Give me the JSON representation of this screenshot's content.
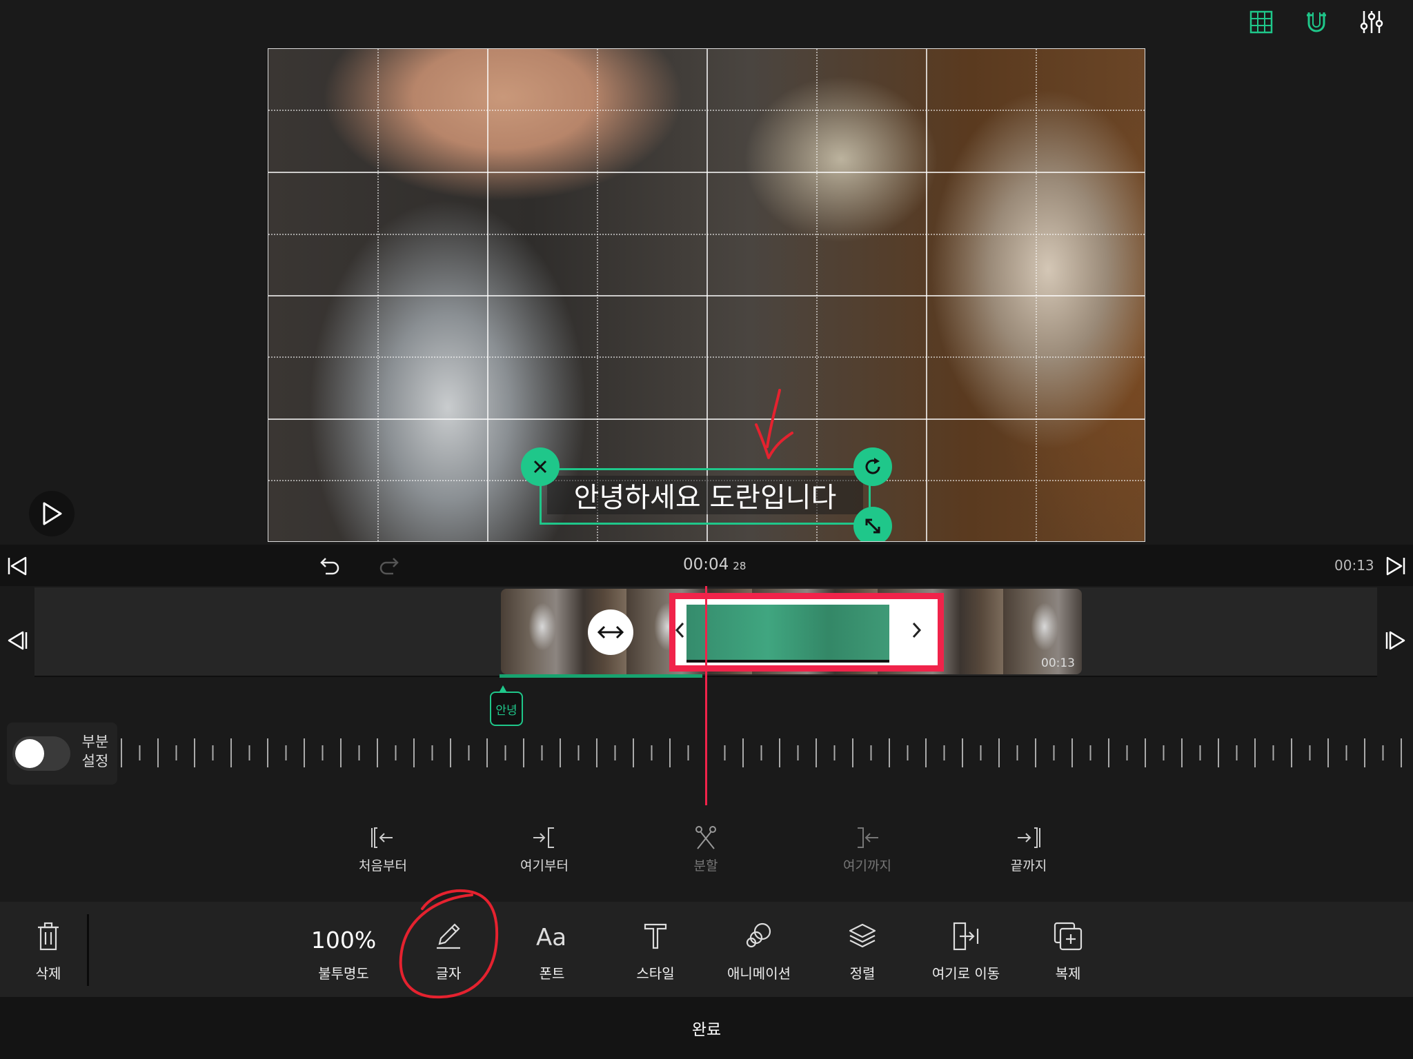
{
  "preview": {
    "caption_text": "안녕하세요 도란입니다"
  },
  "timeline": {
    "current_time": "00:04",
    "current_frames": "28",
    "end_time": "00:13",
    "clip_end_time": "00:13",
    "text_tag": "안녕",
    "partial_toggle_label": "부분 설정",
    "partial_toggle_on": false
  },
  "trim": {
    "from_start": "처음부터",
    "from_here": "여기부터",
    "split": "분할",
    "to_here": "여기까지",
    "to_end": "끝까지"
  },
  "toolbar": {
    "delete": "삭제",
    "opacity_value": "100%",
    "opacity": "불투명도",
    "text": "글자",
    "font": "폰트",
    "style": "스타일",
    "animation": "애니메이션",
    "align": "정렬",
    "move_here": "여기로 이동",
    "duplicate": "복제"
  },
  "footer": {
    "done": "완료"
  },
  "colors": {
    "accent": "#1fc78a",
    "highlight": "#f0234a"
  }
}
